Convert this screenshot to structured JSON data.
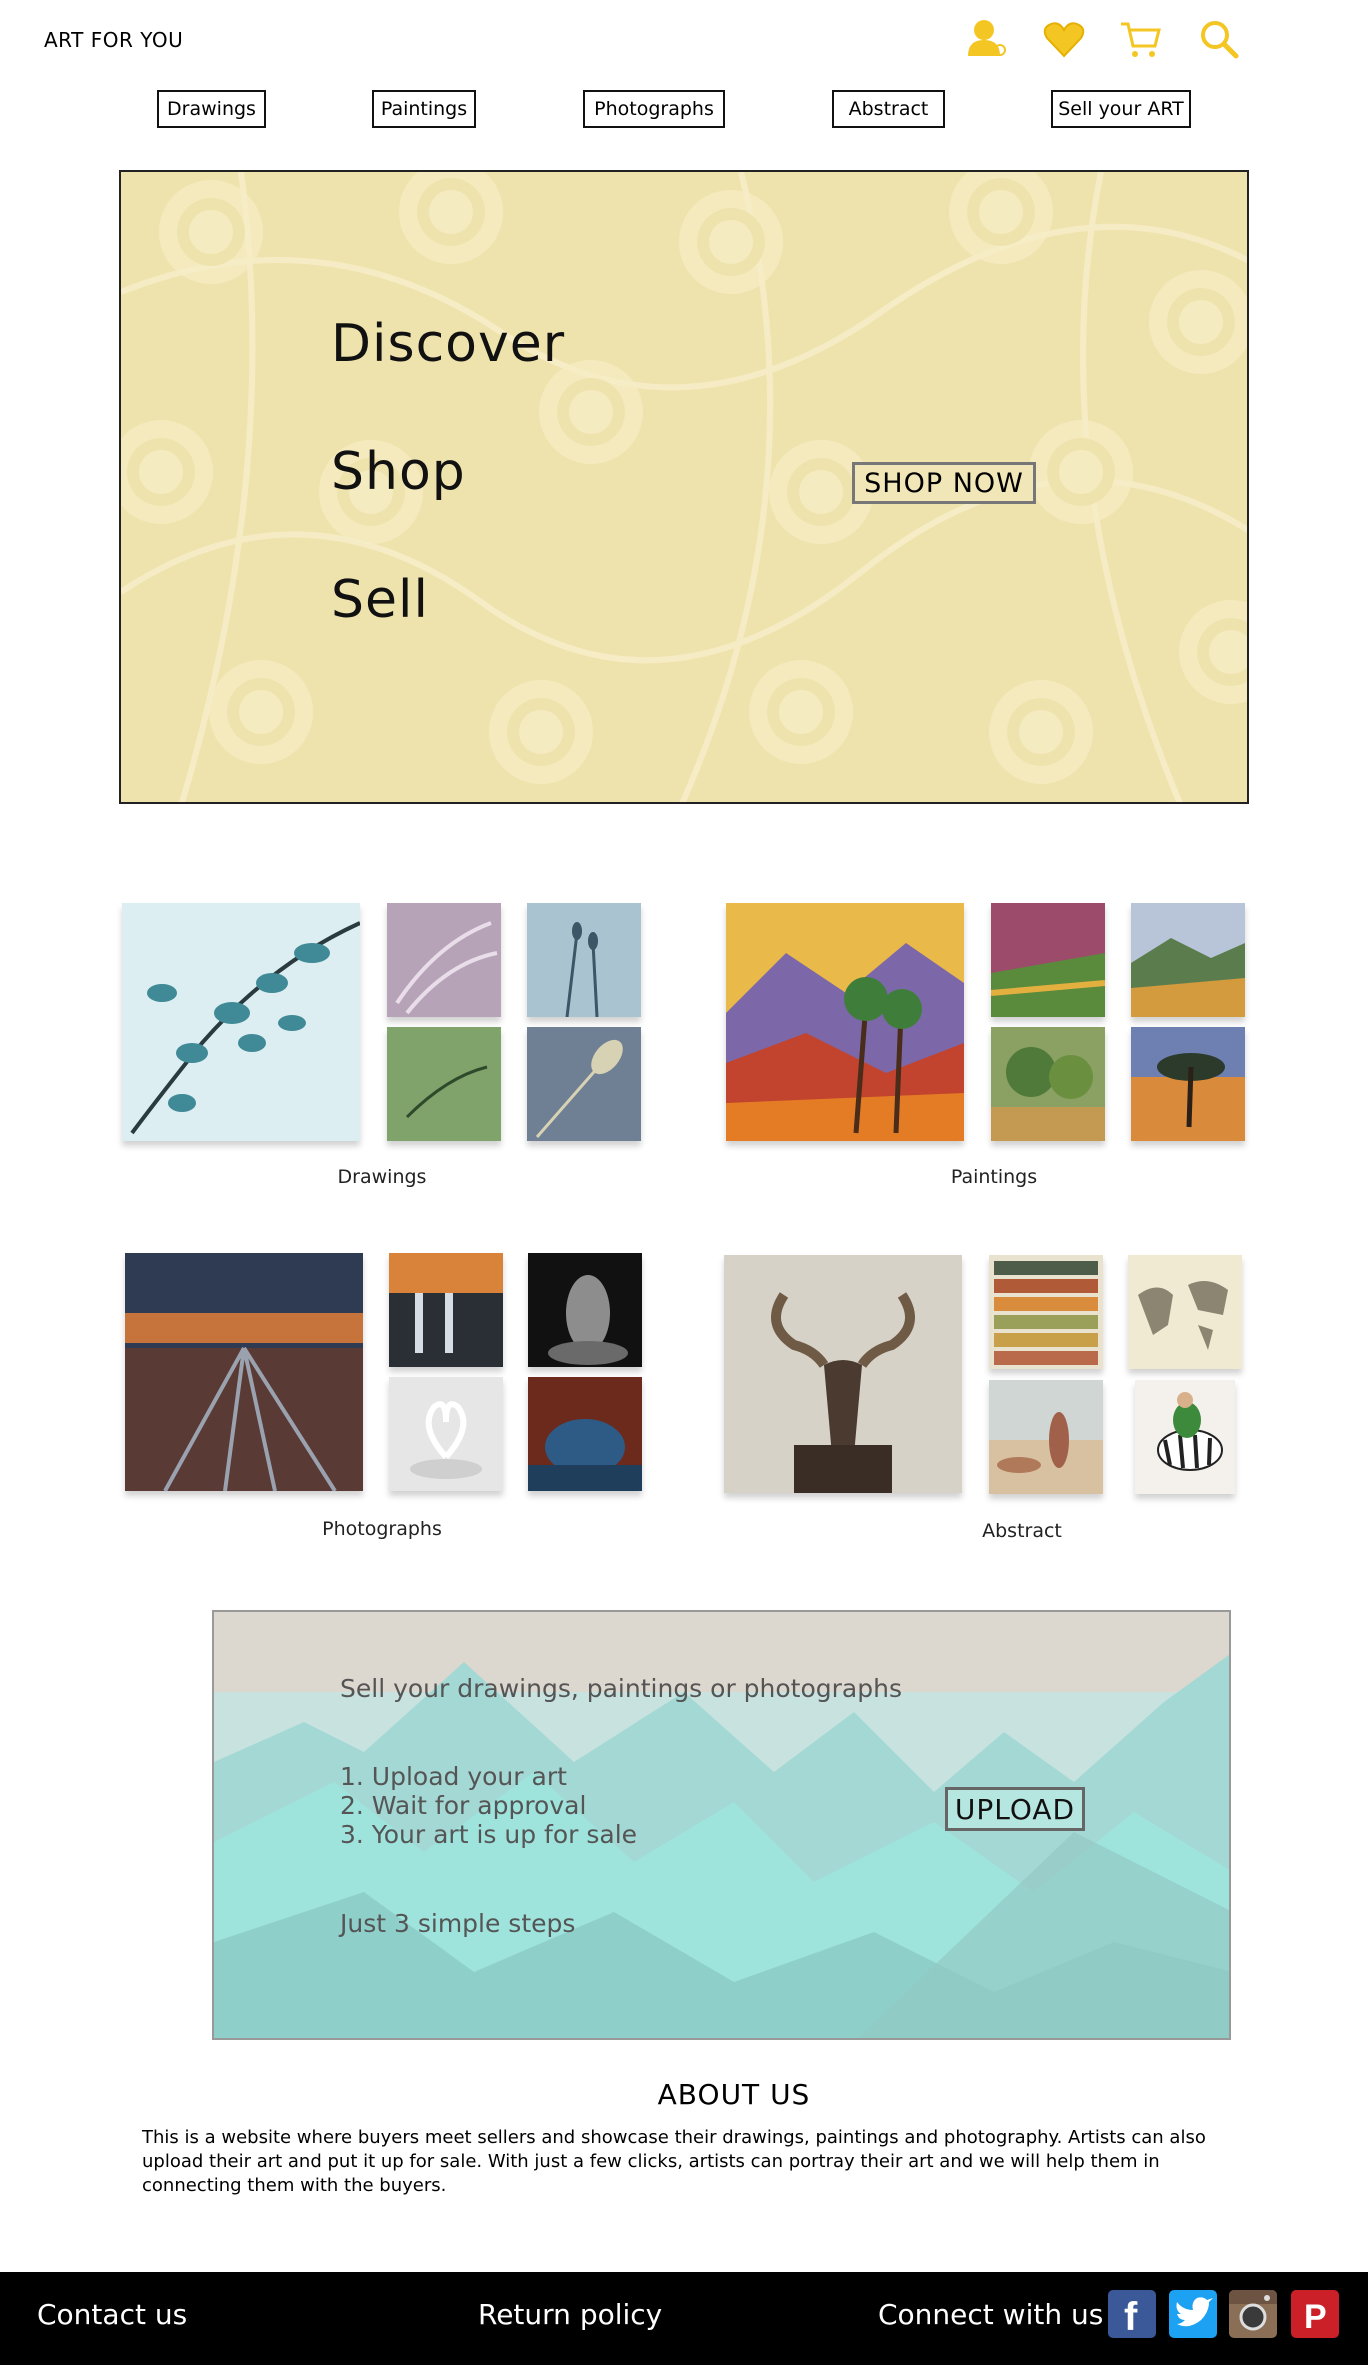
{
  "header": {
    "brand": "ART FOR YOU",
    "icons": [
      "user-icon",
      "heart-icon",
      "cart-icon",
      "search-icon"
    ],
    "accent_color": "#f3c623"
  },
  "nav": [
    "Drawings",
    "Paintings",
    "Photographs",
    "Abstract",
    "Sell your ART"
  ],
  "hero": {
    "words": [
      "Discover",
      "Shop",
      "Sell"
    ],
    "cta": "SHOP NOW",
    "background_color": "#efe3ad"
  },
  "categories": [
    {
      "label": "Drawings"
    },
    {
      "label": "Paintings"
    },
    {
      "label": "Photographs"
    },
    {
      "label": "Abstract"
    }
  ],
  "sell": {
    "heading": "Sell your drawings, paintings or photographs",
    "steps": [
      "1. Upload your art",
      "2. Wait for approval",
      "3. Your art is up for sale"
    ],
    "tagline": "Just 3 simple steps",
    "cta": "UPLOAD"
  },
  "about": {
    "title": "ABOUT US",
    "text": "This is a website where buyers meet sellers and showcase their drawings, paintings and photography. Artists can also upload their art and put it up for sale. With just a few clicks, artists can portray their art and we will help them in connecting them with the buyers."
  },
  "footer": {
    "contact": "Contact us",
    "return": "Return policy",
    "connect": "Connect with us :",
    "social": [
      {
        "name": "facebook-icon",
        "glyph": "f",
        "color": "#3b5998"
      },
      {
        "name": "twitter-icon",
        "glyph": "t",
        "color": "#1da1f2"
      },
      {
        "name": "instagram-icon",
        "glyph": "◎",
        "color": "#8a6e56"
      },
      {
        "name": "pinterest-icon",
        "glyph": "P",
        "color": "#cb2027"
      }
    ]
  }
}
